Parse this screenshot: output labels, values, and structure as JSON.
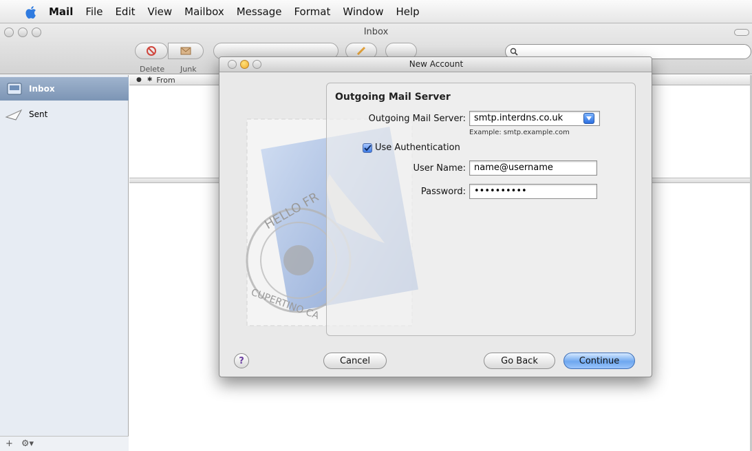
{
  "menubar": {
    "items": [
      "Mail",
      "File",
      "Edit",
      "View",
      "Mailbox",
      "Message",
      "Format",
      "Window",
      "Help"
    ]
  },
  "window": {
    "title": "Inbox",
    "toolbar": {
      "delete_label": "Delete",
      "junk_label": "Junk"
    }
  },
  "sidebar": {
    "mailboxes": [
      {
        "label": "Inbox"
      },
      {
        "label": "Sent"
      }
    ]
  },
  "message_list": {
    "column_from": "From"
  },
  "dialog": {
    "title": "New Account",
    "heading": "Outgoing Mail Server",
    "outgoing_label": "Outgoing Mail Server:",
    "outgoing_value": "smtp.interdns.co.uk",
    "outgoing_hint": "Example: smtp.example.com",
    "use_auth_label": "Use Authentication",
    "use_auth_checked": true,
    "username_label": "User Name:",
    "username_value": "name@username",
    "password_label": "Password:",
    "password_value": "••••••••••",
    "help_label": "?",
    "cancel_label": "Cancel",
    "goback_label": "Go Back",
    "continue_label": "Continue",
    "stamp_text_top": "HELLO FR",
    "stamp_text_bottom": "CUPERTINO CA"
  },
  "colors": {
    "accent": "#3e6fb7",
    "sidebar_bg": "#e7ecf3",
    "selected_row": "#7c95b5"
  }
}
